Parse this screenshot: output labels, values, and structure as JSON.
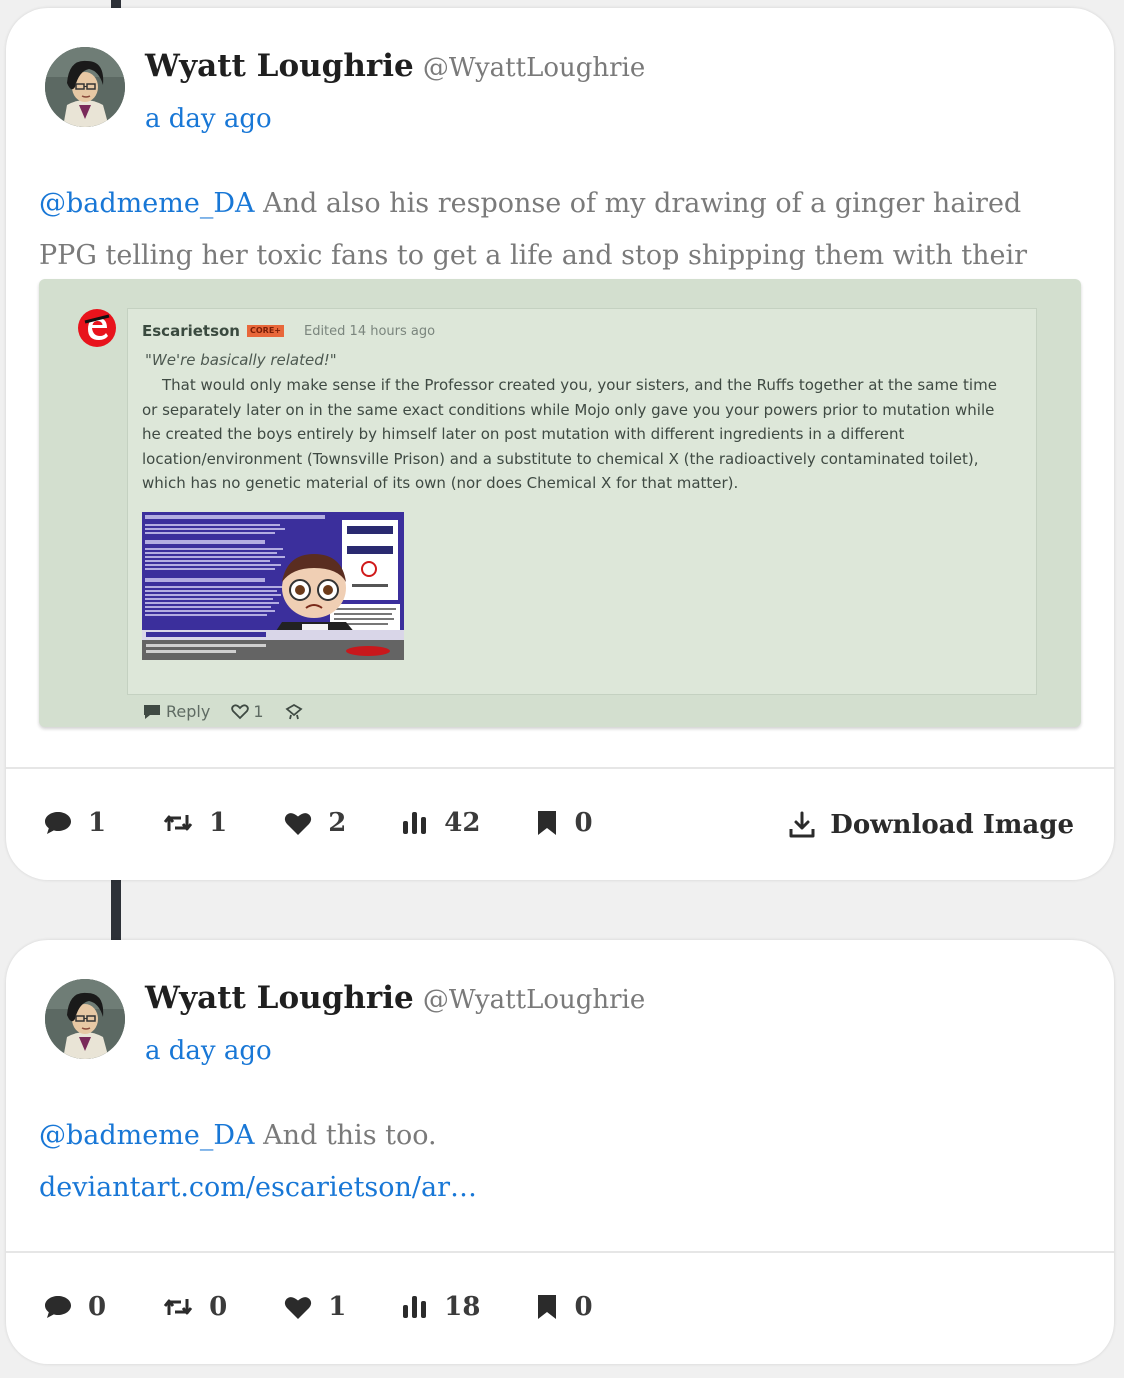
{
  "posts": [
    {
      "display_name": "Wyatt Loughrie",
      "handle": "@WyattLoughrie",
      "timestamp": "a day ago",
      "mention": "@badmeme_DA",
      "text": " And also his response of my drawing of a ginger haired PPG telling her toxic fans to get a life and stop shipping them with their clones.",
      "embedded_image": {
        "author": "Escarietson",
        "badge": "CORE+",
        "edited": "Edited 14 hours ago",
        "quote": "\"We're basically related!\"",
        "body": "That would only make sense if the Professor created you, your sisters, and the Ruffs together at the same time or separately later on in the same exact conditions while Mojo only gave you your powers prior to mutation while he created the boys entirely by himself later on post mutation with different ingredients in a different location/environment (Townsville Prison) and a substitute to chemical X (the radioactively contaminated toilet), which has no genetic material of its own (nor does Chemical X for that matter).",
        "reply_label": "Reply",
        "like_count": "1"
      },
      "stats": {
        "comments": "1",
        "reposts": "1",
        "likes": "2",
        "views": "42",
        "bookmarks": "0"
      },
      "download_label": "Download Image"
    },
    {
      "display_name": "Wyatt Loughrie",
      "handle": "@WyattLoughrie",
      "timestamp": "a day ago",
      "mention": "@badmeme_DA",
      "text": " And this too.",
      "link": "deviantart.com/escarietson/ar…",
      "stats": {
        "comments": "0",
        "reposts": "0",
        "likes": "1",
        "views": "18",
        "bookmarks": "0"
      }
    }
  ],
  "icons": {
    "comment": "comment-icon",
    "repost": "repost-icon",
    "like": "heart-icon",
    "views": "views-icon",
    "bookmark": "bookmark-icon",
    "download": "download-icon"
  },
  "colors": {
    "link": "#1877d6",
    "background": "#f0f0f0",
    "card": "#ffffff",
    "embed_bg": "#d3dfcf"
  }
}
